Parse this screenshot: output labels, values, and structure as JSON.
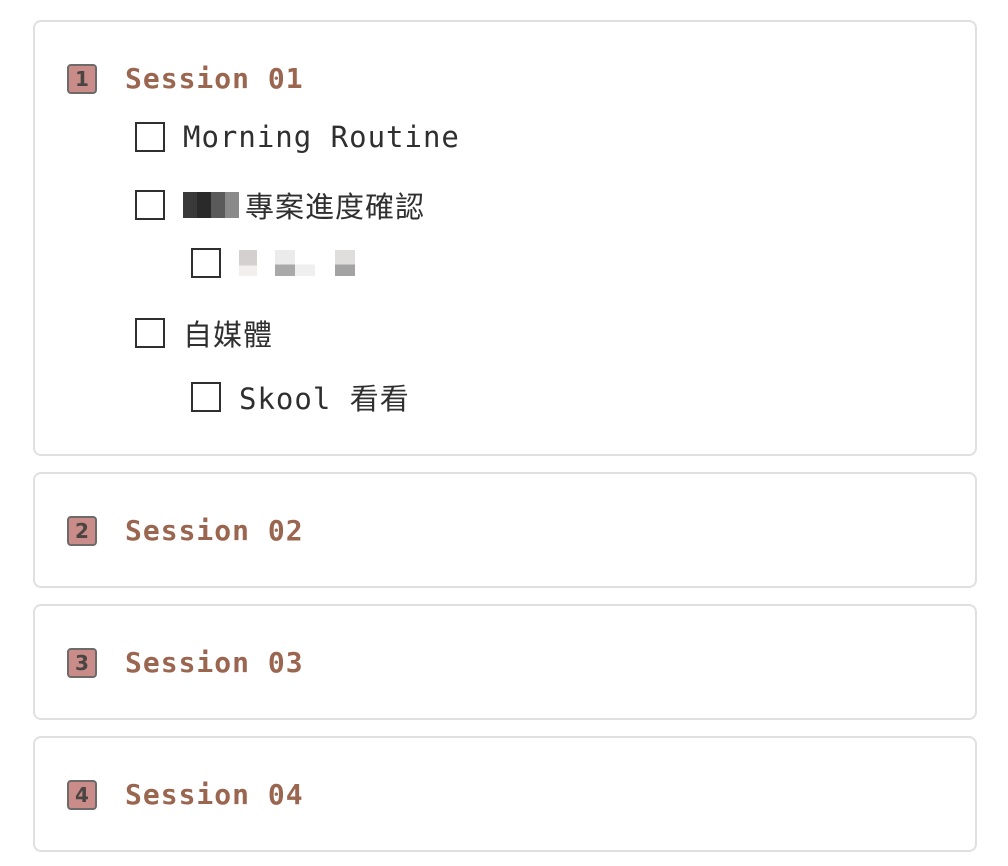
{
  "sessions": [
    {
      "number": "1",
      "title": "Session 01",
      "tasks": [
        {
          "label": "Morning Routine",
          "indent": 0
        },
        {
          "label": "專案進度確認",
          "indent": 0,
          "redacted_prefix": true
        },
        {
          "label": "",
          "indent": 1,
          "redacted_full": true
        },
        {
          "label": "自媒體",
          "indent": 0
        },
        {
          "label": "Skool 看看",
          "indent": 1
        }
      ]
    },
    {
      "number": "2",
      "title": "Session 02"
    },
    {
      "number": "3",
      "title": "Session 03"
    },
    {
      "number": "4",
      "title": "Session 04"
    }
  ],
  "colors": {
    "badge_fill": "#c98c88",
    "badge_border": "#6e6a69",
    "title_color": "#9b6650",
    "card_border": "#e0e0e0",
    "text": "#2f2f2f"
  }
}
